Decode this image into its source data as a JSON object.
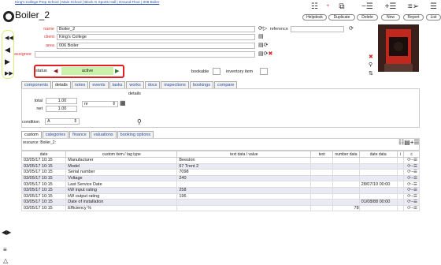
{
  "breadcrumb": "King's College Prep School | Main School | Block G Sports Hall | Ground Floor | 006 Boiler",
  "title": "Boiler_2",
  "toolbar": {
    "helpdesk": "Helpdesk",
    "duplicate": "Duplicate",
    "delete": "Delete",
    "new": "New",
    "report": "Report",
    "list": "List"
  },
  "form": {
    "name_label": "name",
    "name_value": "Boiler_2",
    "client_label": "client",
    "client_value": "King's College",
    "area_label": "area",
    "area_value": "006 Boiler",
    "assignee_label": "assignee",
    "assignee_value": "",
    "reference_label": "reference",
    "reference_value": "",
    "status_label": "status",
    "status_value": "active",
    "bookable_label": "bookable",
    "inventory_label": "inventory item"
  },
  "tabs": [
    "components",
    "details",
    "notes",
    "events",
    "tasks",
    "works",
    "docs",
    "inspections",
    "bookings",
    "compare"
  ],
  "details": {
    "heading": "details",
    "total_label": "total",
    "total_value": "1.00",
    "net_label": "net",
    "net_value": "1.00",
    "unit_value": "nr",
    "condition_label": "condition",
    "condition_value": "A"
  },
  "subtabs": [
    "custom",
    "categories",
    "finance",
    "valuations",
    "booking options"
  ],
  "resource_line": "resource: Boiler_2:",
  "columns": [
    "date",
    "custom item / tag type",
    "text data / value",
    "text",
    "number data",
    "date data",
    "i",
    "c"
  ],
  "rows": [
    {
      "date": "03/05/17 10:15",
      "item": "Manufacturer",
      "value": "Beeston",
      "text": "",
      "num": "",
      "dd": ""
    },
    {
      "date": "03/05/17 10:15",
      "item": "Model",
      "value": "67 Trent 2",
      "text": "",
      "num": "",
      "dd": ""
    },
    {
      "date": "03/05/17 10:15",
      "item": "Serial number",
      "value": "7098",
      "text": "",
      "num": "",
      "dd": ""
    },
    {
      "date": "03/05/17 10:15",
      "item": "Voltage",
      "value": "240",
      "text": "",
      "num": "",
      "dd": ""
    },
    {
      "date": "03/05/17 10:15",
      "item": "Last Service Date",
      "value": "",
      "text": "",
      "num": "",
      "dd": "28/07/10 00:00"
    },
    {
      "date": "03/05/17 10:15",
      "item": "kW input rating",
      "value": "258",
      "text": "",
      "num": "",
      "dd": ""
    },
    {
      "date": "03/05/17 10:15",
      "item": "kW output rating",
      "value": "196",
      "text": "",
      "num": "",
      "dd": ""
    },
    {
      "date": "03/05/17 10:15",
      "item": "Date of installation",
      "value": "",
      "text": "",
      "num": "",
      "dd": "01/08/88 00:00"
    },
    {
      "date": "03/05/17 10:15",
      "item": "Efficiency %",
      "value": "",
      "text": "",
      "num": "78",
      "dd": ""
    }
  ],
  "colors": {
    "status_green": "#c9f2a8",
    "highlight": "#e21e1e",
    "nav_border": "#d6ef70"
  }
}
